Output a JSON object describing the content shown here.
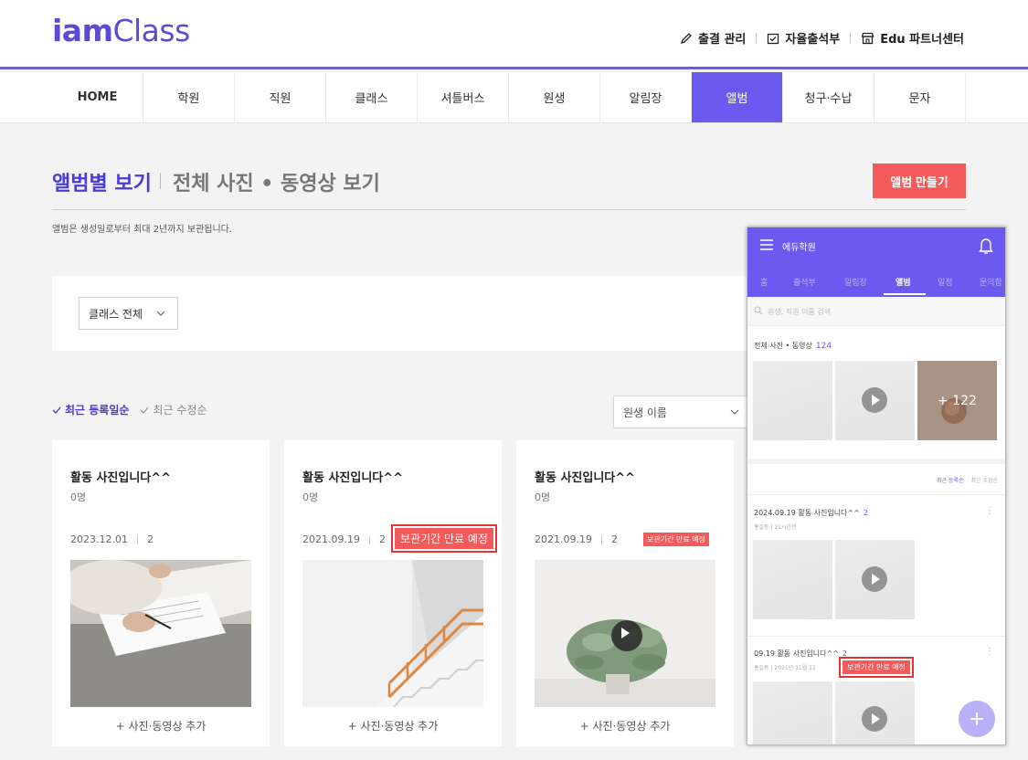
{
  "header": {
    "logo_bold": "iam",
    "logo_light": "Class",
    "util": [
      {
        "label": "출결 관리",
        "icon": "pencil-icon"
      },
      {
        "label": "자율출석부",
        "icon": "calendar-check-icon"
      },
      {
        "label": "Edu 파트너센터",
        "icon": "store-icon"
      }
    ]
  },
  "nav": {
    "items": [
      "HOME",
      "학원",
      "직원",
      "클래스",
      "셔틀버스",
      "원생",
      "알림장",
      "앨범",
      "청구·수납",
      "문자"
    ],
    "active": "앨범"
  },
  "page": {
    "title_active": "앨범별 보기",
    "title_inactive": "전체 사진 • 동영상 보기",
    "create_button": "앨범 만들기",
    "notice": "앨범은 생성일로부터 최대 2년까지 보관됩니다.",
    "class_filter": "클래스 전체",
    "sort_active": "최근 등록일순",
    "sort_inactive": "최근 수정순",
    "student_select": "원생 이름"
  },
  "cards": [
    {
      "title": "활동 사진입니다^^",
      "count": "0명",
      "date": "2023.12.01",
      "photos": "2",
      "badge": "",
      "add": "+ 사진·동영상 추가"
    },
    {
      "title": "활동 사진입니다^^",
      "count": "0명",
      "date": "2021.09.19",
      "photos": "2",
      "badge": "보관기간 만료 예정",
      "add": "+ 사진·동영상 추가"
    },
    {
      "title": "활동 사진입니다^^",
      "count": "0명",
      "date": "2021.09.19",
      "photos": "2",
      "badge": "보관기간 만료 예정",
      "add": "+ 사진·동영상 추가"
    }
  ],
  "mobile": {
    "title": "에듀학원",
    "tabs": [
      "홈",
      "출석부",
      "알림장",
      "앨범",
      "일정",
      "문의함"
    ],
    "active_tab": "앨범",
    "search_placeholder": "원생, 직원 이름 검색",
    "all_label": "전체 사진 • 동영상",
    "all_count": "124",
    "more_count": "+ 122",
    "sort_active": "최근 등록순",
    "sort_inactive": "최근 수정순",
    "post1_title": "2024.09.19 활동 사진입니다^^",
    "post1_count": "2",
    "post1_sub": "홍길동 | 21시간전",
    "post2_title": "09.19 활동 사진입니다^^",
    "post2_count": "2",
    "post2_sub": "홍길동 | 2021년 11월 12",
    "badge": "보관기간 만료 예정",
    "fab": "+"
  },
  "colors": {
    "brand": "#6a5af0",
    "accent_red": "#f35a5a"
  }
}
